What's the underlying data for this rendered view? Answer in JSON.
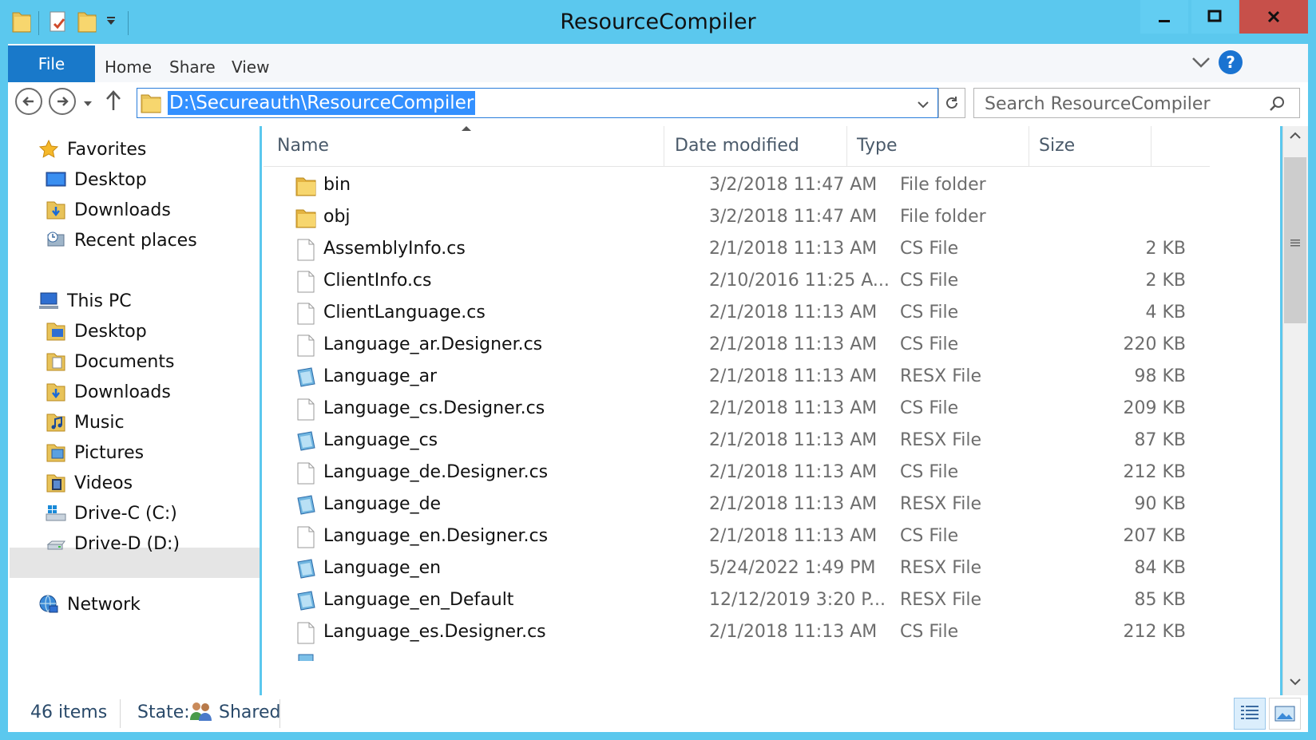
{
  "window": {
    "title": "ResourceCompiler"
  },
  "ribbon": {
    "file": "File",
    "tabs": [
      "Home",
      "Share",
      "View"
    ]
  },
  "address": {
    "path": "D:\\Secureauth\\ResourceCompiler",
    "search_placeholder": "Search ResourceCompiler"
  },
  "navpane": {
    "favorites": {
      "label": "Favorites",
      "items": [
        "Desktop",
        "Downloads",
        "Recent places"
      ]
    },
    "this_pc": {
      "label": "This PC",
      "items": [
        "Desktop",
        "Documents",
        "Downloads",
        "Music",
        "Pictures",
        "Videos",
        "Drive-C (C:)",
        "Drive-D (D:)"
      ]
    },
    "network": {
      "label": "Network"
    },
    "selected": "Drive-D (D:)"
  },
  "columns": {
    "name": "Name",
    "date": "Date modified",
    "type": "Type",
    "size": "Size"
  },
  "files": [
    {
      "name": "bin",
      "date": "3/2/2018 11:47 AM",
      "type": "File folder",
      "size": "",
      "icon": "folder-icon"
    },
    {
      "name": "obj",
      "date": "3/2/2018 11:47 AM",
      "type": "File folder",
      "size": "",
      "icon": "folder-icon"
    },
    {
      "name": "AssemblyInfo.cs",
      "date": "2/1/2018 11:13 AM",
      "type": "CS File",
      "size": "2 KB",
      "icon": "file-icon"
    },
    {
      "name": "ClientInfo.cs",
      "date": "2/10/2016 11:25 A...",
      "type": "CS File",
      "size": "2 KB",
      "icon": "file-icon"
    },
    {
      "name": "ClientLanguage.cs",
      "date": "2/1/2018 11:13 AM",
      "type": "CS File",
      "size": "4 KB",
      "icon": "file-icon"
    },
    {
      "name": "Language_ar.Designer.cs",
      "date": "2/1/2018 11:13 AM",
      "type": "CS File",
      "size": "220 KB",
      "icon": "file-icon"
    },
    {
      "name": "Language_ar",
      "date": "2/1/2018 11:13 AM",
      "type": "RESX File",
      "size": "98 KB",
      "icon": "resx-icon"
    },
    {
      "name": "Language_cs.Designer.cs",
      "date": "2/1/2018 11:13 AM",
      "type": "CS File",
      "size": "209 KB",
      "icon": "file-icon"
    },
    {
      "name": "Language_cs",
      "date": "2/1/2018 11:13 AM",
      "type": "RESX File",
      "size": "87 KB",
      "icon": "resx-icon"
    },
    {
      "name": "Language_de.Designer.cs",
      "date": "2/1/2018 11:13 AM",
      "type": "CS File",
      "size": "212 KB",
      "icon": "file-icon"
    },
    {
      "name": "Language_de",
      "date": "2/1/2018 11:13 AM",
      "type": "RESX File",
      "size": "90 KB",
      "icon": "resx-icon"
    },
    {
      "name": "Language_en.Designer.cs",
      "date": "2/1/2018 11:13 AM",
      "type": "CS File",
      "size": "207 KB",
      "icon": "file-icon"
    },
    {
      "name": "Language_en",
      "date": "5/24/2022 1:49 PM",
      "type": "RESX File",
      "size": "84 KB",
      "icon": "resx-icon"
    },
    {
      "name": "Language_en_Default",
      "date": "12/12/2019 3:20 P...",
      "type": "RESX File",
      "size": "85 KB",
      "icon": "resx-icon"
    },
    {
      "name": "Language_es.Designer.cs",
      "date": "2/1/2018 11:13 AM",
      "type": "CS File",
      "size": "212 KB",
      "icon": "file-icon"
    }
  ],
  "status": {
    "count": "46 items",
    "state_label": "State:",
    "state_value": "Shared"
  },
  "colors": {
    "titlebar": "#5bc8ee",
    "file_tab": "#1979ca",
    "close": "#c7504a",
    "selection": "#3390ff"
  }
}
